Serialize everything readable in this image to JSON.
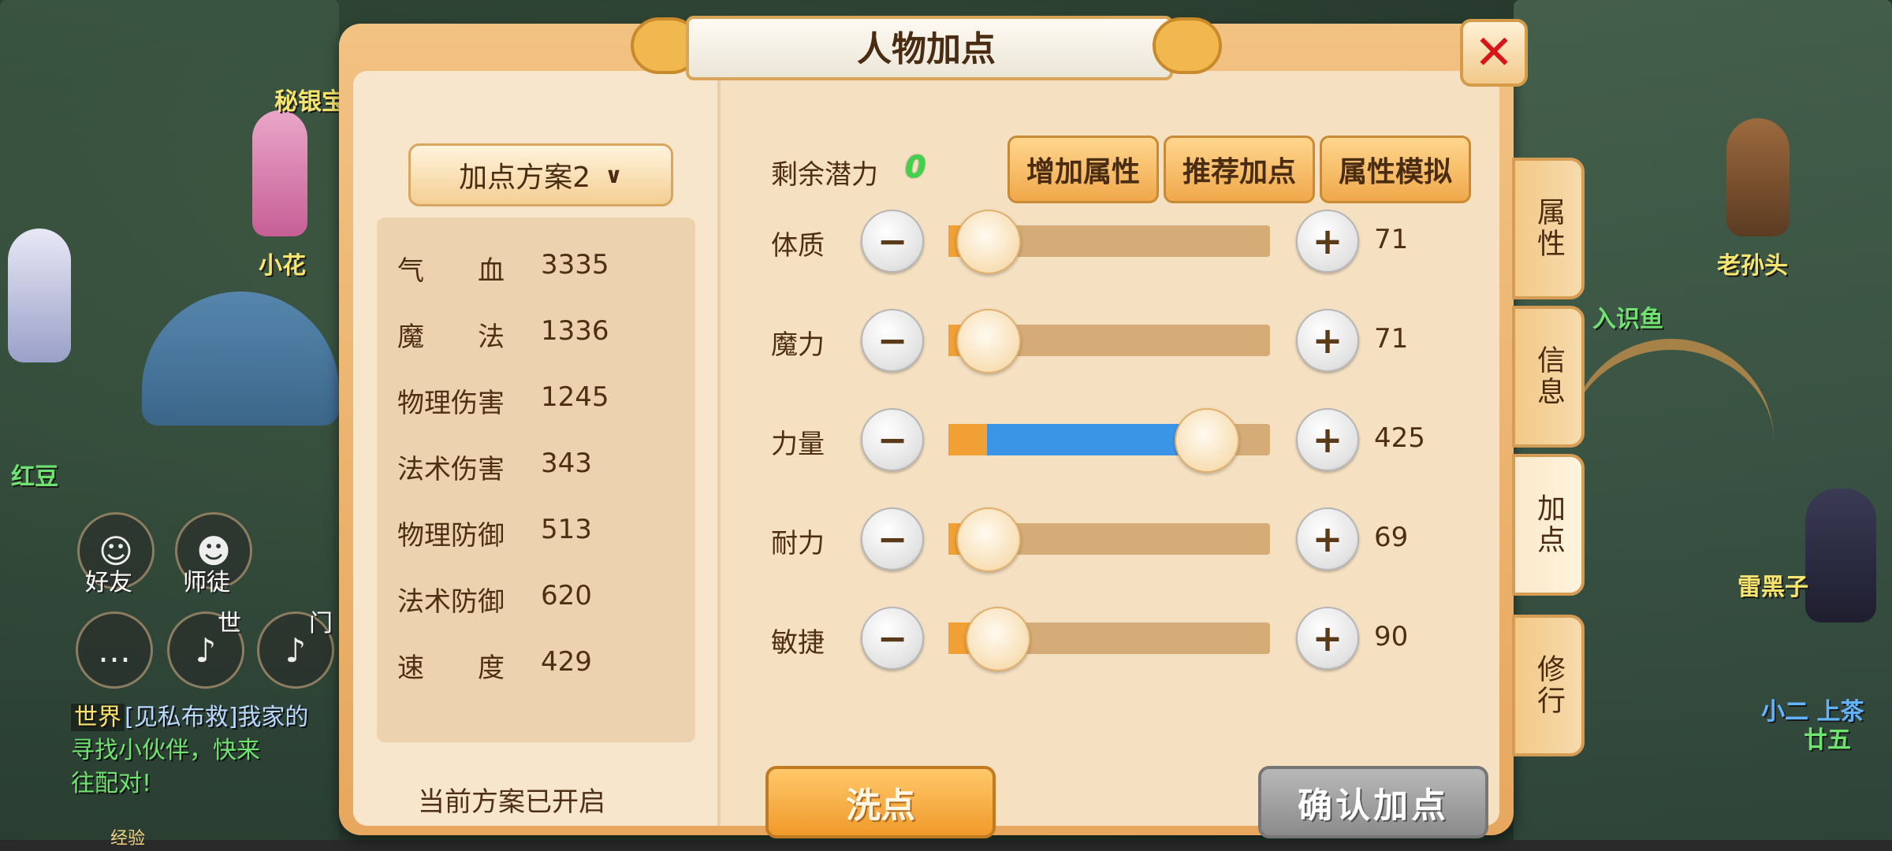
{
  "panel": {
    "title": "人物加点",
    "scheme_label": "加点方案2",
    "scheme_status": "当前方案已开启"
  },
  "stats": [
    {
      "label": "气　　血",
      "value": "3335"
    },
    {
      "label": "魔　　法",
      "value": "1336"
    },
    {
      "label": "物理伤害",
      "value": "1245"
    },
    {
      "label": "法术伤害",
      "value": "343"
    },
    {
      "label": "物理防御",
      "value": "513"
    },
    {
      "label": "法术防御",
      "value": "620"
    },
    {
      "label": "速　　度",
      "value": "429"
    }
  ],
  "potential": {
    "label": "剩余潜力",
    "value": "0"
  },
  "top_buttons": {
    "add": "增加属性",
    "recommend": "推荐加点",
    "simulate": "属性模拟"
  },
  "attributes": [
    {
      "name": "体质",
      "value": "71",
      "base_fraction": 0.1,
      "added_fraction": 0.0
    },
    {
      "name": "魔力",
      "value": "71",
      "base_fraction": 0.1,
      "added_fraction": 0.0
    },
    {
      "name": "力量",
      "value": "425",
      "base_fraction": 0.12,
      "added_fraction": 0.66
    },
    {
      "name": "耐力",
      "value": "69",
      "base_fraction": 0.1,
      "added_fraction": 0.0
    },
    {
      "name": "敏捷",
      "value": "90",
      "base_fraction": 0.13,
      "added_fraction": 0.0
    }
  ],
  "bottom_buttons": {
    "wash": "洗点",
    "confirm": "确认加点"
  },
  "side_tabs": [
    "属性",
    "信息",
    "加点",
    "修行"
  ],
  "active_tab": "加点",
  "background": {
    "names": [
      "秘银宝",
      "小花",
      "老孙头",
      "雷黑子",
      "红豆",
      "入识鱼",
      "廿五",
      "小二 上茶"
    ],
    "hud": {
      "friends": "好友",
      "master": "师徒",
      "world_tab": "世",
      "door_tab": "门"
    },
    "chat_tag": "世界",
    "chat_line1": "[见私布救]我家的",
    "chat_line2": "寻找小伙伴，快来",
    "chat_line3": "往配对!",
    "exp_label": "经验"
  },
  "colors": {
    "frame": "#e7a75e",
    "inner": "#f5e0c2",
    "base_fill": "#f0a035",
    "added_fill": "#3b95e6",
    "potential_green": "#3fd34a",
    "close_red": "#d8141b"
  }
}
